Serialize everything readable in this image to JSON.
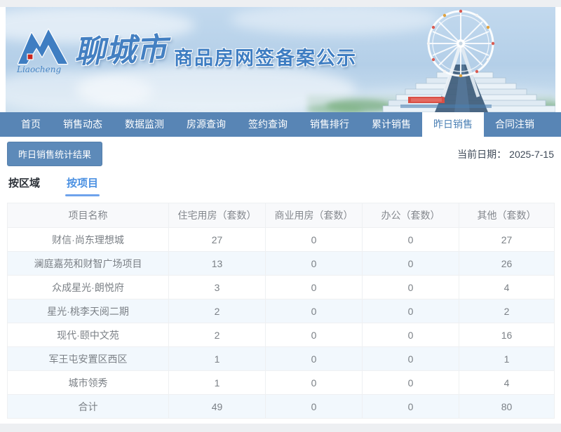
{
  "banner": {
    "logo_text": "Liaocheng",
    "city_name": "聊城市",
    "title": "商品房网签备案公示"
  },
  "nav": {
    "items": [
      {
        "label": "首页",
        "active": false
      },
      {
        "label": "销售动态",
        "active": false
      },
      {
        "label": "数据监测",
        "active": false
      },
      {
        "label": "房源查询",
        "active": false
      },
      {
        "label": "签约查询",
        "active": false
      },
      {
        "label": "销售排行",
        "active": false
      },
      {
        "label": "累计销售",
        "active": false
      },
      {
        "label": "昨日销售",
        "active": true
      },
      {
        "label": "合同注销",
        "active": false
      }
    ]
  },
  "toolbar": {
    "result_button_label": "昨日销售统计结果",
    "date_label": "当前日期：",
    "date_value": "2025-7-15"
  },
  "subtabs": [
    {
      "label": "按区域",
      "active": false
    },
    {
      "label": "按项目",
      "active": true
    }
  ],
  "table": {
    "columns": [
      "项目名称",
      "住宅用房（套数）",
      "商业用房（套数）",
      "办公（套数）",
      "其他（套数）"
    ],
    "rows": [
      [
        "财信·尚东理想城",
        "27",
        "0",
        "0",
        "27"
      ],
      [
        "澜庭嘉苑和财智广场项目",
        "13",
        "0",
        "0",
        "26"
      ],
      [
        "众成星光·朗悦府",
        "3",
        "0",
        "0",
        "4"
      ],
      [
        "星光·桃李天阅二期",
        "2",
        "0",
        "0",
        "2"
      ],
      [
        "现代·颐中文苑",
        "2",
        "0",
        "0",
        "16"
      ],
      [
        "军王屯安置区西区",
        "1",
        "0",
        "0",
        "1"
      ],
      [
        "城市领秀",
        "1",
        "0",
        "0",
        "4"
      ],
      [
        "合计",
        "49",
        "0",
        "0",
        "80"
      ]
    ]
  },
  "colors": {
    "nav_blue": "#5885b5",
    "nav_active_text": "#4a7fb4",
    "button_blue": "#5d8ab9",
    "subtab_active_blue": "#4a90e2",
    "banner_title_blue": "#3e7dc2",
    "zebra_row": "#f2f8fd",
    "table_header_bg": "#f8f9fb",
    "logo_red": "#c9251d"
  }
}
